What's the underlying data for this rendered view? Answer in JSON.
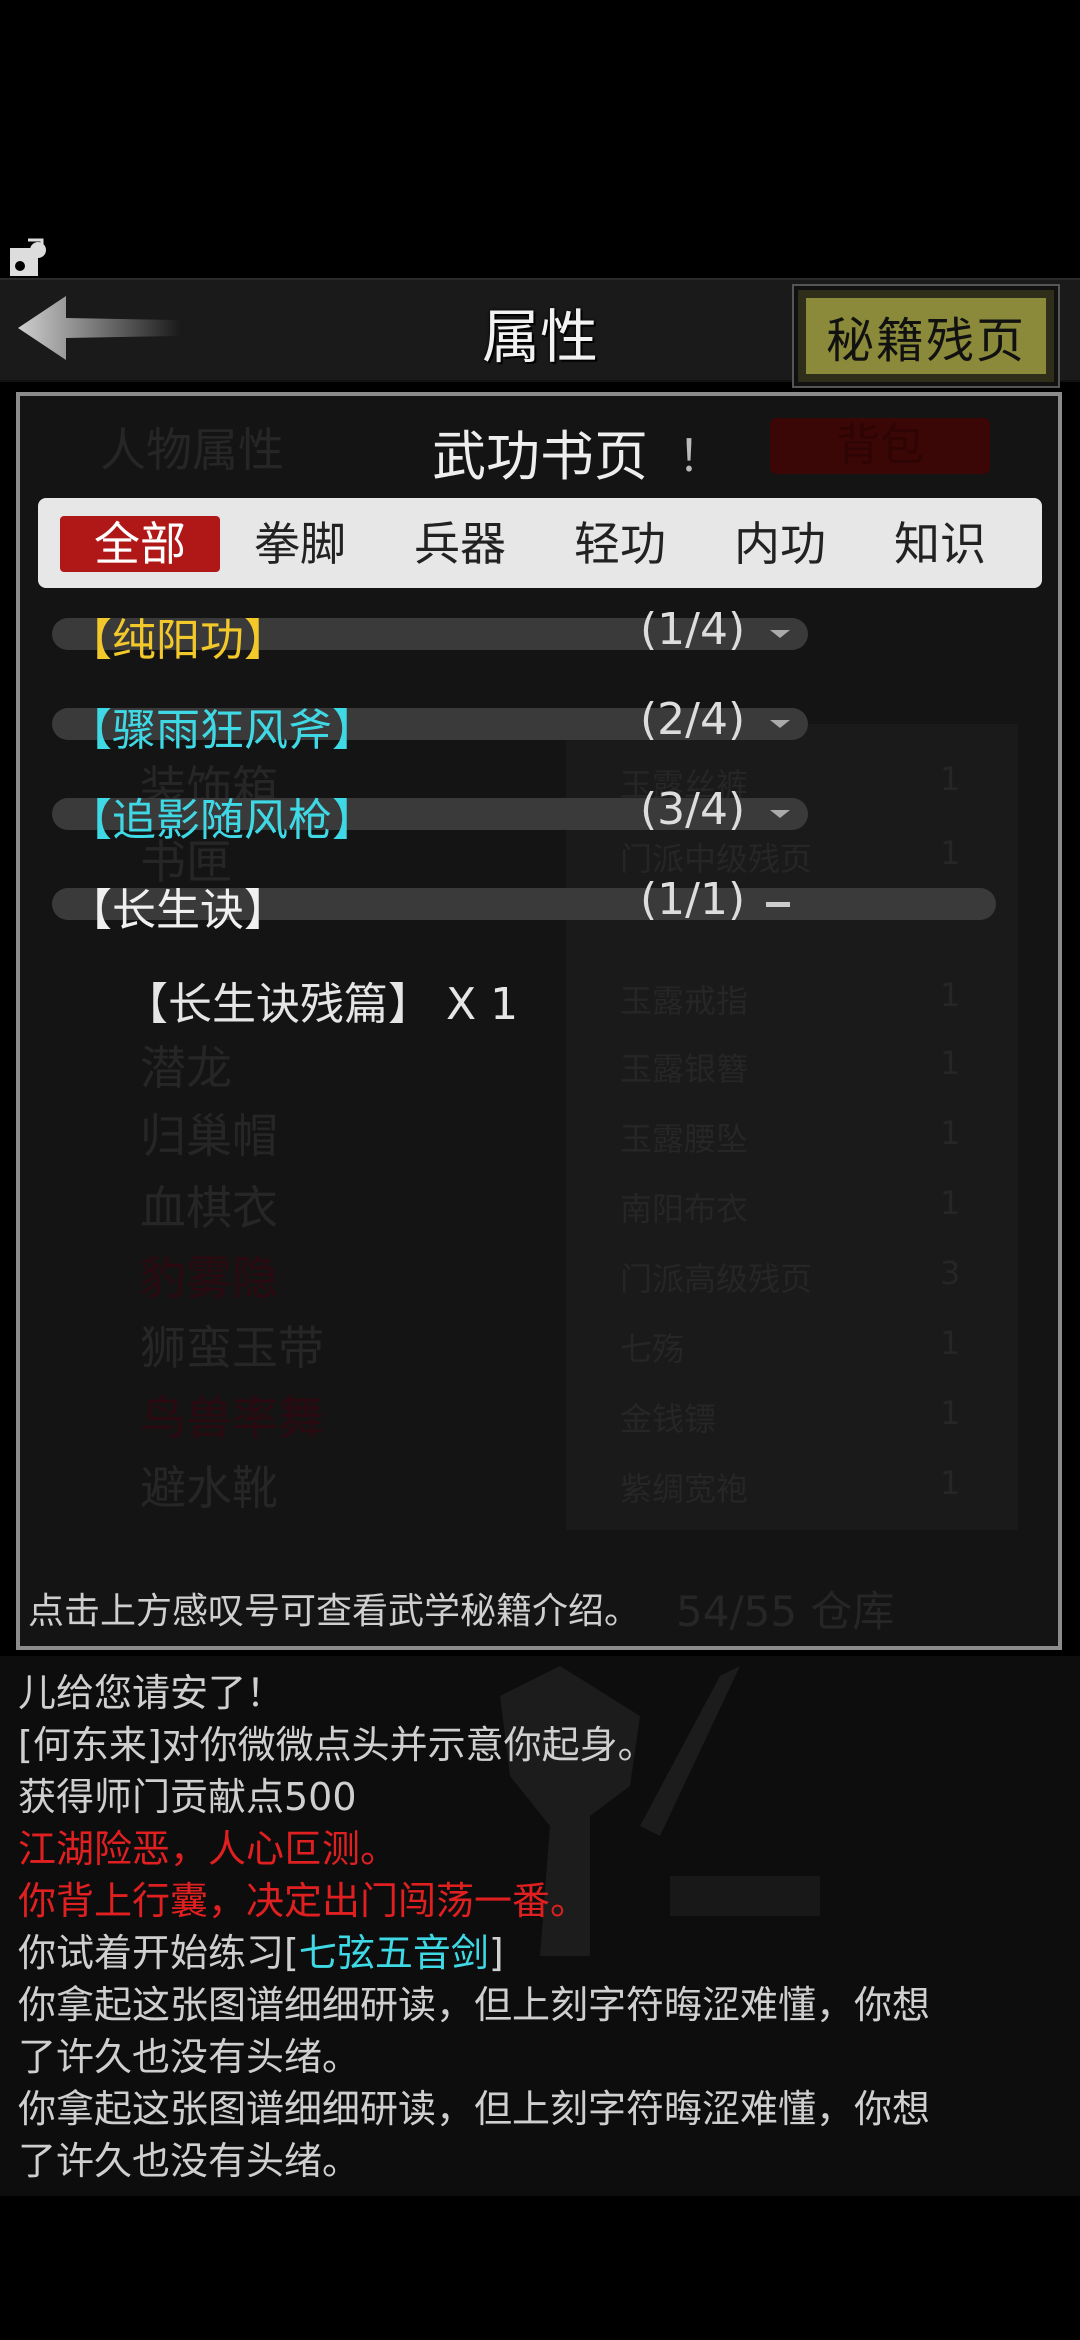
{
  "header": {
    "title": "属性",
    "secret_button": "秘籍残页"
  },
  "background_ui": {
    "tab_left": "人物属性",
    "tab_right": "背包",
    "list": [
      "装饰箱",
      "书匣",
      "潜龙",
      "归巢帽",
      "血棋衣",
      "豹雾隐",
      "狮蛮玉带",
      "鸟兽率舞",
      "避水靴"
    ],
    "items": [
      {
        "name": "玉露丝裤",
        "qty": "1"
      },
      {
        "name": "门派中级残页",
        "qty": "1"
      },
      {
        "name": "玉露戒指",
        "qty": "1"
      },
      {
        "name": "玉露银簪",
        "qty": "1"
      },
      {
        "name": "玉露腰坠",
        "qty": "1"
      },
      {
        "name": "南阳布衣",
        "qty": "1"
      },
      {
        "name": "门派高级残页",
        "qty": "3"
      },
      {
        "name": "七殇",
        "qty": "1"
      },
      {
        "name": "金钱镖",
        "qty": "1"
      },
      {
        "name": "紫绸宽袍",
        "qty": "1"
      }
    ],
    "capacity": "54/55 仓库"
  },
  "dialog": {
    "title": "武功书页",
    "info_mark": "！",
    "tabs": [
      "全部",
      "拳脚",
      "兵器",
      "轻功",
      "内功",
      "知识"
    ],
    "active_tab": "全部",
    "entries": [
      {
        "name": "【纯阳功】",
        "count": "(1/4)",
        "color": "#f3c82b",
        "expanded": false
      },
      {
        "name": "【骤雨狂风斧】",
        "count": "(2/4)",
        "color": "#3fd9e6",
        "expanded": false
      },
      {
        "name": "【追影随风枪】",
        "count": "(3/4)",
        "color": "#3fd9e6",
        "expanded": false
      },
      {
        "name": "【长生诀】",
        "count": "(1/1)",
        "color": "#f0f0f0",
        "expanded": true
      }
    ],
    "sub_item": "【长生诀残篇】 X 1",
    "hint": "点击上方感叹号可查看武学秘籍介绍。"
  },
  "log": {
    "lines": [
      {
        "text": "儿给您请安了！",
        "color": "normal"
      },
      {
        "text": "[何东来]对你微微点头并示意你起身。",
        "color": "normal"
      },
      {
        "text": "获得师门贡献点500",
        "color": "normal"
      },
      {
        "text": "江湖险恶，人心叵测。",
        "color": "red"
      },
      {
        "text": "你背上行囊，决定出门闯荡一番。",
        "color": "red"
      },
      {
        "text": "你试着开始练习[",
        "color": "normal"
      },
      {
        "text": "七弦五音剑",
        "color": "cyan"
      },
      {
        "text": "]",
        "color": "normal"
      },
      {
        "text": "你拿起这张图谱细细研读，但上刻字符晦涩难懂，你想",
        "color": "normal"
      },
      {
        "text": "了许久也没有头绪。",
        "color": "normal"
      },
      {
        "text": "你拿起这张图谱细细研读，但上刻字符晦涩难懂，你想",
        "color": "normal"
      },
      {
        "text": "了许久也没有头绪。",
        "color": "normal"
      }
    ]
  }
}
